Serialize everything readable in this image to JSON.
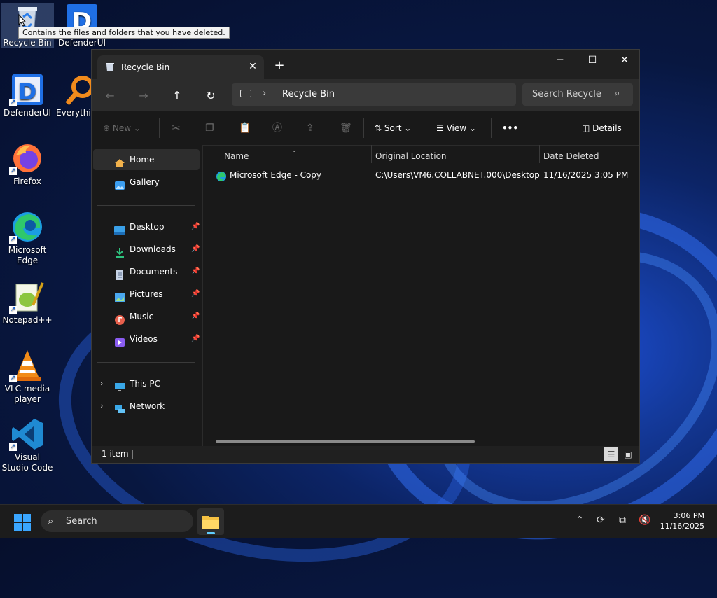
{
  "desktop": {
    "icons": [
      {
        "label": "Recycle Bin"
      },
      {
        "label": "DefenderUI"
      },
      {
        "label": "DefenderUI"
      },
      {
        "label": "Everythi"
      },
      {
        "label": "Firefox"
      },
      {
        "label": "Microsoft Edge"
      },
      {
        "label": "Notepad++"
      },
      {
        "label": "VLC media player"
      },
      {
        "label": "Visual Studio Code"
      }
    ],
    "tooltip": "Contains the files and folders that you have deleted."
  },
  "window": {
    "tab_title": "Recycle Bin",
    "address": {
      "location": "Recycle Bin"
    },
    "search": {
      "placeholder": "Search Recycle Bin"
    },
    "commands": {
      "new": "New",
      "sort": "Sort",
      "view": "View",
      "more": "•••",
      "details": "Details"
    },
    "nav": {
      "items": [
        {
          "label": "Home"
        },
        {
          "label": "Gallery"
        },
        {
          "label": "Desktop"
        },
        {
          "label": "Downloads"
        },
        {
          "label": "Documents"
        },
        {
          "label": "Pictures"
        },
        {
          "label": "Music"
        },
        {
          "label": "Videos"
        },
        {
          "label": "This PC"
        },
        {
          "label": "Network"
        }
      ]
    },
    "columns": {
      "name": "Name",
      "original_location": "Original Location",
      "date_deleted": "Date Deleted"
    },
    "files": [
      {
        "name": "Microsoft Edge - Copy",
        "original_location": "C:\\Users\\VM6.COLLABNET.000\\Desktop",
        "date_deleted": "11/16/2025 3:05 PM"
      }
    ],
    "status": "1 item"
  },
  "taskbar": {
    "search_label": "Search",
    "time": "3:06 PM",
    "date": "11/16/2025"
  },
  "colors": {
    "accent": "#0078d4",
    "window_bg": "#191919",
    "taskbar_bg": "#1c1c1c"
  }
}
